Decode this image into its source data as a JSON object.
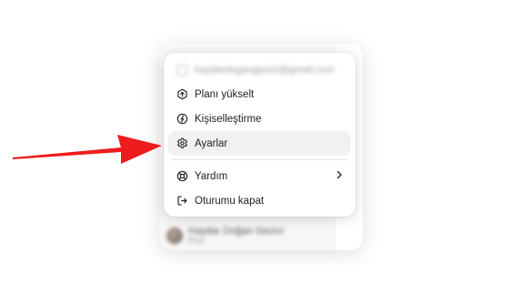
{
  "background": {
    "profile_name": "Haydar Doğan Gezici",
    "profile_plan": "Plus"
  },
  "menu": {
    "email": "haydardogangezici@gmail.com",
    "items": [
      {
        "label": "Planı yükselt",
        "icon": "upgrade-icon"
      },
      {
        "label": "Kişiselleştirme",
        "icon": "personalize-icon"
      },
      {
        "label": "Ayarlar",
        "icon": "gear-icon",
        "highlighted": true
      },
      {
        "label": "Yardım",
        "icon": "help-icon",
        "has_submenu": true
      },
      {
        "label": "Oturumu kapat",
        "icon": "logout-icon"
      }
    ]
  },
  "annotation": {
    "arrow_color": "#ee1c1c",
    "target": "Ayarlar"
  }
}
